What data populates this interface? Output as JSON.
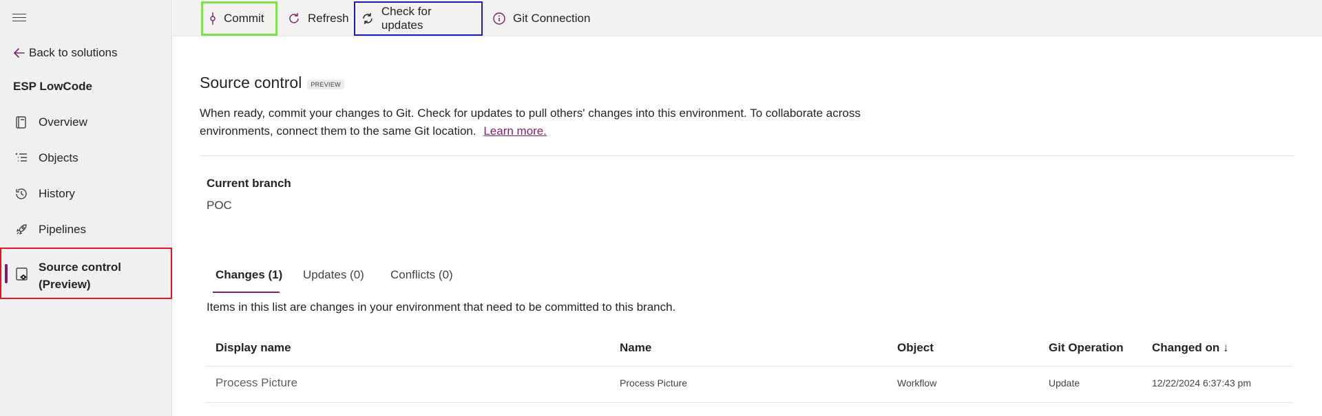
{
  "sidebar": {
    "back_label": "Back to solutions",
    "solution_name": "ESP LowCode",
    "items": [
      {
        "label": "Overview",
        "icon": "book-icon"
      },
      {
        "label": "Objects",
        "icon": "list-icon"
      },
      {
        "label": "History",
        "icon": "history-icon"
      },
      {
        "label": "Pipelines",
        "icon": "rocket-icon"
      }
    ],
    "active_item": {
      "label": "Source control (Preview)",
      "icon": "source-control-icon"
    }
  },
  "toolbar": {
    "commit_label": "Commit",
    "refresh_label": "Refresh",
    "check_label": "Check for updates",
    "git_label": "Git Connection"
  },
  "page": {
    "title": "Source control",
    "badge": "PREVIEW",
    "description": "When ready, commit your changes to Git. Check for updates to pull others' changes into this environment. To collaborate across environments, connect them to the same Git location.",
    "learn_more": "Learn more.",
    "branch_label": "Current branch",
    "branch_value": "POC",
    "tabs": [
      {
        "label": "Changes (1)"
      },
      {
        "label": "Updates (0)"
      },
      {
        "label": "Conflicts (0)"
      }
    ],
    "info_text": "Items in this list are changes in your environment that need to be committed to this branch."
  },
  "table": {
    "headers": [
      "Display name",
      "Name",
      "Object",
      "Git Operation",
      "Changed on ↓"
    ],
    "rows": [
      [
        "Process Picture",
        "Process Picture",
        "Workflow",
        "Update",
        "12/22/2024 6:37:43 pm"
      ]
    ]
  },
  "colors": {
    "accent": "#7a1f6e",
    "commit_highlight": "#7fe050",
    "check_highlight": "#1a1ab0",
    "active_nav_highlight": "#e81123"
  }
}
